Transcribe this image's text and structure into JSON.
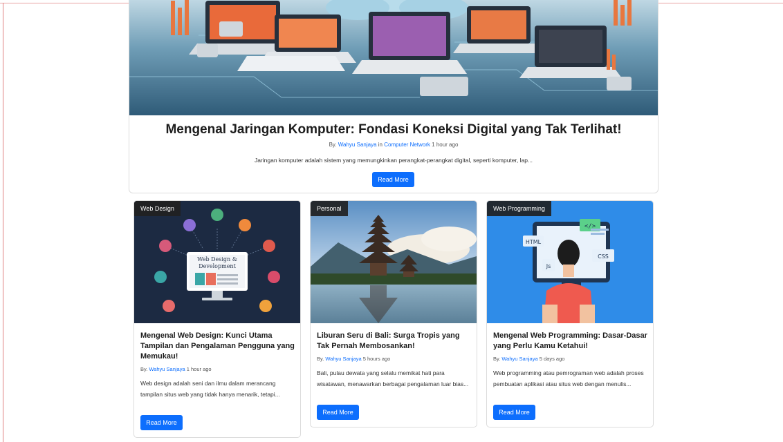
{
  "featured": {
    "title": "Mengenal Jaringan Komputer: Fondasi Koneksi Digital yang Tak Terlihat!",
    "meta_by": "By.",
    "author": "Wahyu Sanjaya",
    "meta_in": "in",
    "category": "Computer Network",
    "time": "1 hour ago",
    "excerpt": "Jaringan komputer adalah sistem yang memungkinkan perangkat-perangkat digital, seperti komputer, lap...",
    "button": "Read More"
  },
  "posts": [
    {
      "badge": "Web Design",
      "image_text": [
        "Web Design &",
        "Development"
      ],
      "title": "Mengenal Web Design: Kunci Utama Tampilan dan Pengalaman Pengguna yang Memukau!",
      "meta_by": "By.",
      "author": "Wahyu Sanjaya",
      "time": "1 hour ago",
      "excerpt": "Web design adalah seni dan ilmu dalam merancang tampilan situs web yang tidak hanya menarik, tetapi...",
      "button": "Read More"
    },
    {
      "badge": "Personal",
      "title": "Liburan Seru di Bali: Surga Tropis yang Tak Pernah Membosankan!",
      "meta_by": "By.",
      "author": "Wahyu Sanjaya",
      "time": "5 hours ago",
      "excerpt": "Bali, pulau dewata yang selalu memikat hati para wisatawan, menawarkan berbagai pengalaman luar bias...",
      "button": "Read More"
    },
    {
      "badge": "Web Programming",
      "image_labels": [
        "</>",
        "HTML",
        "CSS",
        "Js"
      ],
      "title": "Mengenal Web Programming: Dasar-Dasar yang Perlu Kamu Ketahui!",
      "meta_by": "By.",
      "author": "Wahyu Sanjaya",
      "time": "5 days ago",
      "excerpt": "Web programming atau pemrograman web adalah proses pembuatan aplikasi atau situs web dengan menulis...",
      "button": "Read More"
    }
  ],
  "colors": {
    "primary": "#0d6efd",
    "badge_bg": "#212121"
  }
}
